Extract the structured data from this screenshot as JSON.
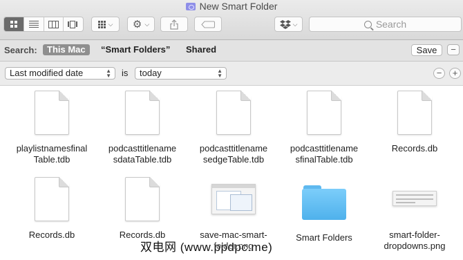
{
  "window": {
    "title": "New Smart Folder"
  },
  "toolbar": {
    "view_buttons": [
      "icon-view",
      "list-view",
      "column-view",
      "cover-flow-view"
    ],
    "search_placeholder": "Search"
  },
  "scope_bar": {
    "label": "Search:",
    "scopes": [
      "This Mac",
      "“Smart Folders”",
      "Shared"
    ],
    "active_scope": "This Mac",
    "save_label": "Save",
    "remove_label": "−"
  },
  "criteria": {
    "attribute": "Last modified date",
    "operator": "is",
    "value": "today",
    "remove_label": "−",
    "add_label": "+"
  },
  "files": [
    {
      "name": "playlistnamesfinal\nTable.tdb",
      "kind": "document"
    },
    {
      "name": "podcasttitlename\nsdataTable.tdb",
      "kind": "document"
    },
    {
      "name": "podcasttitlename\nsedgeTable.tdb",
      "kind": "document"
    },
    {
      "name": "podcasttitlename\nsfinalTable.tdb",
      "kind": "document"
    },
    {
      "name": "Records.db",
      "kind": "document"
    },
    {
      "name": "Records.db",
      "kind": "document"
    },
    {
      "name": "Records.db",
      "kind": "document"
    },
    {
      "name": "save-mac-smart-\nfolder.png",
      "kind": "screenshot"
    },
    {
      "name": "Smart Folders",
      "kind": "folder"
    },
    {
      "name": "smart-folder-\ndropdowns.png",
      "kind": "screenshot-wide"
    }
  ],
  "watermark": "双电网 (www.ppdpc.me)"
}
